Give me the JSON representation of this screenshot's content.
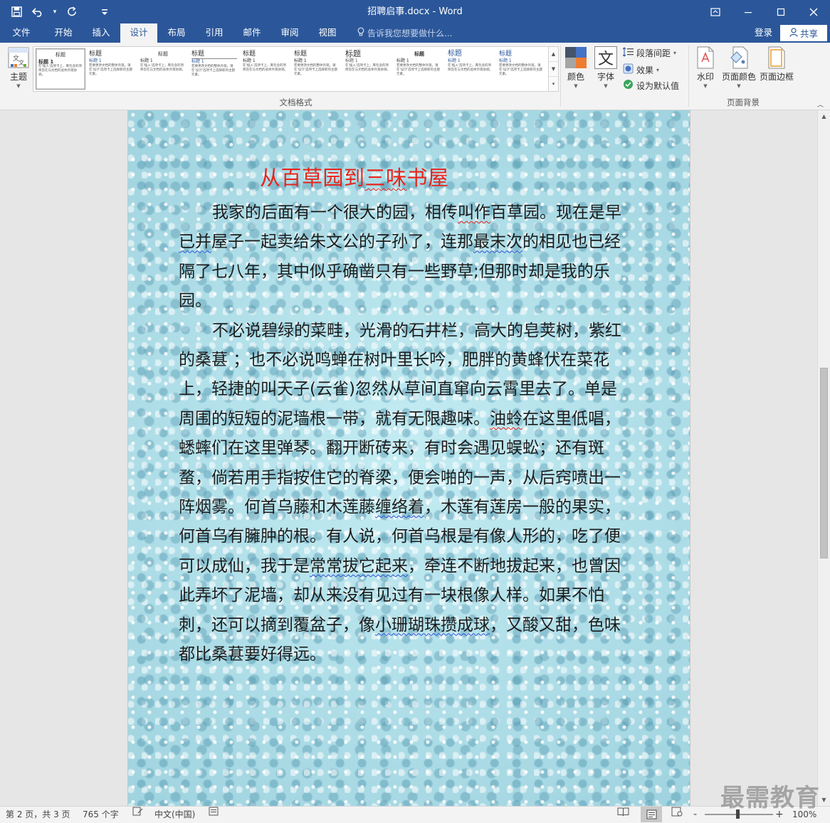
{
  "window": {
    "title": "招聘启事.docx - Word"
  },
  "tabs": [
    {
      "label": "文件"
    },
    {
      "label": "开始"
    },
    {
      "label": "插入"
    },
    {
      "label": "设计"
    },
    {
      "label": "布局"
    },
    {
      "label": "引用"
    },
    {
      "label": "邮件"
    },
    {
      "label": "审阅"
    },
    {
      "label": "视图"
    }
  ],
  "active_tab": "设计",
  "tell_me": {
    "placeholder": "告诉我您想要做什么..."
  },
  "account": {
    "login": "登录",
    "share": "共享"
  },
  "ribbon": {
    "theme_label": "主题",
    "gallery": {
      "items": [
        {
          "heading": "标题",
          "sub": "标题 1",
          "body": "在'插入'选项卡上，库包含的项目旨在与文档的总体外观协调。"
        },
        {
          "heading": "标题",
          "sub": "标题 1",
          "body": "若要更改文档的整体外观，请在'设计'选项卡上选择新的主题元素。"
        },
        {
          "heading": "标题",
          "sub": "标题 1",
          "body": "在'插入'选项卡上，库包含的项目旨在与文档的总体外观协调。"
        },
        {
          "heading": "标题",
          "sub": "标题 1",
          "body": "若要更改文档的整体外观，请在'设计'选项卡上选择新的主题元素。"
        },
        {
          "heading": "标题",
          "sub": "标题 1",
          "body": "在'插入'选项卡上，库包含的项目旨在与文档的总体外观协调。"
        },
        {
          "heading": "标题",
          "sub": "标题 1",
          "body": "若要更改文档的整体外观，请在'设计'选项卡上选择新的主题元素。"
        },
        {
          "heading": "标题",
          "sub": "标题 1",
          "body": "在'插入'选项卡上，库包含的项目旨在与文档的总体外观协调。"
        },
        {
          "heading": "标题",
          "sub": "标题 1",
          "body": "若要更改文档的整体外观，请在'设计'选项卡上选择新的主题元素。"
        },
        {
          "heading": "标题",
          "sub": "标题 1",
          "body": "在'插入'选项卡上，库包含的项目旨在与文档的总体外观协调。"
        },
        {
          "heading": "标题",
          "sub": "标题 1",
          "body": "若要更改文档的整体外观，请在'设计'选项卡上选择新的主题元素。"
        }
      ]
    },
    "doc_format_label": "文档格式",
    "colors_label": "颜色",
    "fonts_label": "字体",
    "fonts_glyph": "文",
    "paragraph_spacing_label": "段落间距",
    "effects_label": "效果",
    "set_default_label": "设为默认值",
    "watermark_label": "水印",
    "page_color_label": "页面颜色",
    "page_border_label": "页面边框",
    "page_background_label": "页面背景"
  },
  "document": {
    "title_part1": "从百草园到",
    "title_part2": "三味",
    "title_part3": "书屋",
    "lines": [
      {
        "indent": true,
        "segments": [
          {
            "t": "我家的后面有一个很大的园，相传"
          },
          {
            "t": "叫作",
            "s": "red"
          },
          {
            "t": "百草园。现在是早"
          }
        ]
      },
      {
        "indent": false,
        "segments": [
          {
            "t": "已并",
            "s": "blue"
          },
          {
            "t": "屋子一起卖给朱文公的子孙了，连那"
          },
          {
            "t": "最末次",
            "s": "blue"
          },
          {
            "t": "的相见也已经"
          }
        ]
      },
      {
        "indent": false,
        "segments": [
          {
            "t": "隔了七八年，其中似乎确凿只有一些野草;但那时却是我的乐"
          }
        ]
      },
      {
        "indent": false,
        "segments": [
          {
            "t": "园。"
          }
        ]
      },
      {
        "indent": true,
        "segments": [
          {
            "t": "不必说碧绿的菜畦，光滑的石井栏，高大的皂荚树，紫红"
          }
        ]
      },
      {
        "indent": false,
        "segments": [
          {
            "t": "的桑葚 ；也不必说鸣蝉在树叶里长吟，肥胖的黄蜂伏在菜花"
          }
        ]
      },
      {
        "indent": false,
        "segments": [
          {
            "t": "上，轻捷的叫天子(云雀)忽然从草间直窜向云霄里去了。单是"
          }
        ]
      },
      {
        "indent": false,
        "segments": [
          {
            "t": "周围的短短的泥墙根一带，就有无限趣味。"
          },
          {
            "t": "油蛉",
            "s": "red"
          },
          {
            "t": "在这里低唱，"
          }
        ]
      },
      {
        "indent": false,
        "segments": [
          {
            "t": "蟋蟀们在这里弹琴。翻开断砖来，有时会遇见蜈蚣；还有斑"
          }
        ]
      },
      {
        "indent": false,
        "segments": [
          {
            "t": "蝥，倘若用手指按住它的脊梁，便会啪的一声，从后窍喷出一"
          }
        ]
      },
      {
        "indent": false,
        "segments": [
          {
            "t": "阵烟雾。何首乌藤和木莲藤"
          },
          {
            "t": "缠络着",
            "s": "blue"
          },
          {
            "t": "，木莲有莲房一般的果实，"
          }
        ]
      },
      {
        "indent": false,
        "segments": [
          {
            "t": "何首乌有臃肿的根。有人说，何首乌根是有像人形的，吃了便"
          }
        ]
      },
      {
        "indent": false,
        "segments": [
          {
            "t": "可以成仙，我于是"
          },
          {
            "t": "常常拔它起来",
            "s": "blue"
          },
          {
            "t": "，牵连不断地拔起来，也曾因"
          }
        ]
      },
      {
        "indent": false,
        "segments": [
          {
            "t": "此弄坏了泥墙，却从来没有见过有一块根像人样。如果不怕"
          }
        ]
      },
      {
        "indent": false,
        "segments": [
          {
            "t": "刺，还可以摘到覆盆子，像"
          },
          {
            "t": "小珊瑚珠攒成球",
            "s": "blue"
          },
          {
            "t": "，又酸又甜，色味"
          }
        ]
      },
      {
        "indent": false,
        "segments": [
          {
            "t": "都比桑葚要好得远。"
          }
        ]
      }
    ]
  },
  "status": {
    "page": "第 2 页，共 3 页",
    "words": "765 个字",
    "language": "中文(中国)",
    "zoom": "100%",
    "zoom_minus": "-",
    "zoom_plus": "+"
  },
  "watermark_text": "最需教育",
  "colors": {
    "word_blue": "#2b579a",
    "title_red": "#e8241c",
    "page_bg": "#a9dbe6"
  }
}
